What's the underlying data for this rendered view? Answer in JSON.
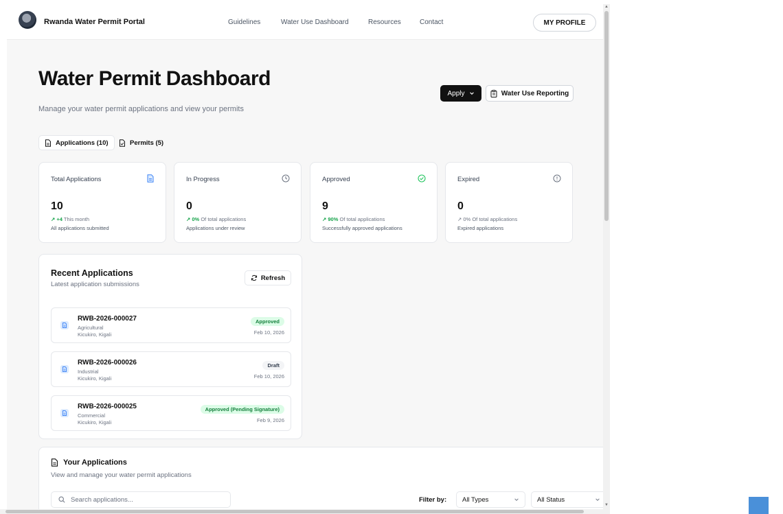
{
  "header": {
    "brand": "Rwanda Water Permit Portal",
    "nav": [
      "Guidelines",
      "Water Use Dashboard",
      "Resources",
      "Contact"
    ],
    "profile_label": "MY PROFILE"
  },
  "page": {
    "title": "Water Permit Dashboard",
    "subtitle": "Manage your water permit applications and view your permits",
    "apply_label": "Apply",
    "reporting_label": "Water Use Reporting"
  },
  "tabs": [
    {
      "label": "Applications (10)"
    },
    {
      "label": "Permits (5)"
    }
  ],
  "stats": [
    {
      "label": "Total Applications",
      "value": "10",
      "trend_value": "+4",
      "trend_text": "This month",
      "description": "All applications submitted",
      "icon": "document-icon",
      "icon_color": "#3b82f6"
    },
    {
      "label": "In Progress",
      "value": "0",
      "trend_value": "0%",
      "trend_text": "Of total applications",
      "description": "Applications under review",
      "icon": "clock-icon",
      "icon_color": "#6b7280"
    },
    {
      "label": "Approved",
      "value": "9",
      "trend_value": "90%",
      "trend_text": "Of total applications",
      "description": "Successfully approved applications",
      "icon": "check-circle-icon",
      "icon_color": "#22c55e"
    },
    {
      "label": "Expired",
      "value": "0",
      "trend_value": "0%",
      "trend_text": "Of total applications",
      "description": "Expired applications",
      "icon": "alert-circle-icon",
      "icon_color": "#6b7280"
    }
  ],
  "recent": {
    "title": "Recent Applications",
    "subtitle": "Latest application submissions",
    "refresh_label": "Refresh",
    "items": [
      {
        "id": "RWB-2026-000027",
        "type": "Agricultural",
        "location": "Kicukiro, Kigali",
        "status": "Approved",
        "date": "Feb 10, 2026",
        "status_color": "green"
      },
      {
        "id": "RWB-2026-000026",
        "type": "Industrial",
        "location": "Kicukiro, Kigali",
        "status": "Draft",
        "date": "Feb 10, 2026",
        "status_color": "gray"
      },
      {
        "id": "RWB-2026-000025",
        "type": "Commercial",
        "location": "Kicukiro, Kigali",
        "status": "Approved (Pending Signature)",
        "date": "Feb 9, 2026",
        "status_color": "green"
      }
    ]
  },
  "yours": {
    "title": "Your Applications",
    "subtitle": "View and manage your water permit applications",
    "search_placeholder": "Search applications...",
    "filter_label": "Filter by:",
    "type_filter": "All Types",
    "status_filter": "All Status"
  },
  "colors": {
    "accent_dark": "#111111",
    "success": "#16a34a",
    "brand_blue": "#3b82f6"
  }
}
